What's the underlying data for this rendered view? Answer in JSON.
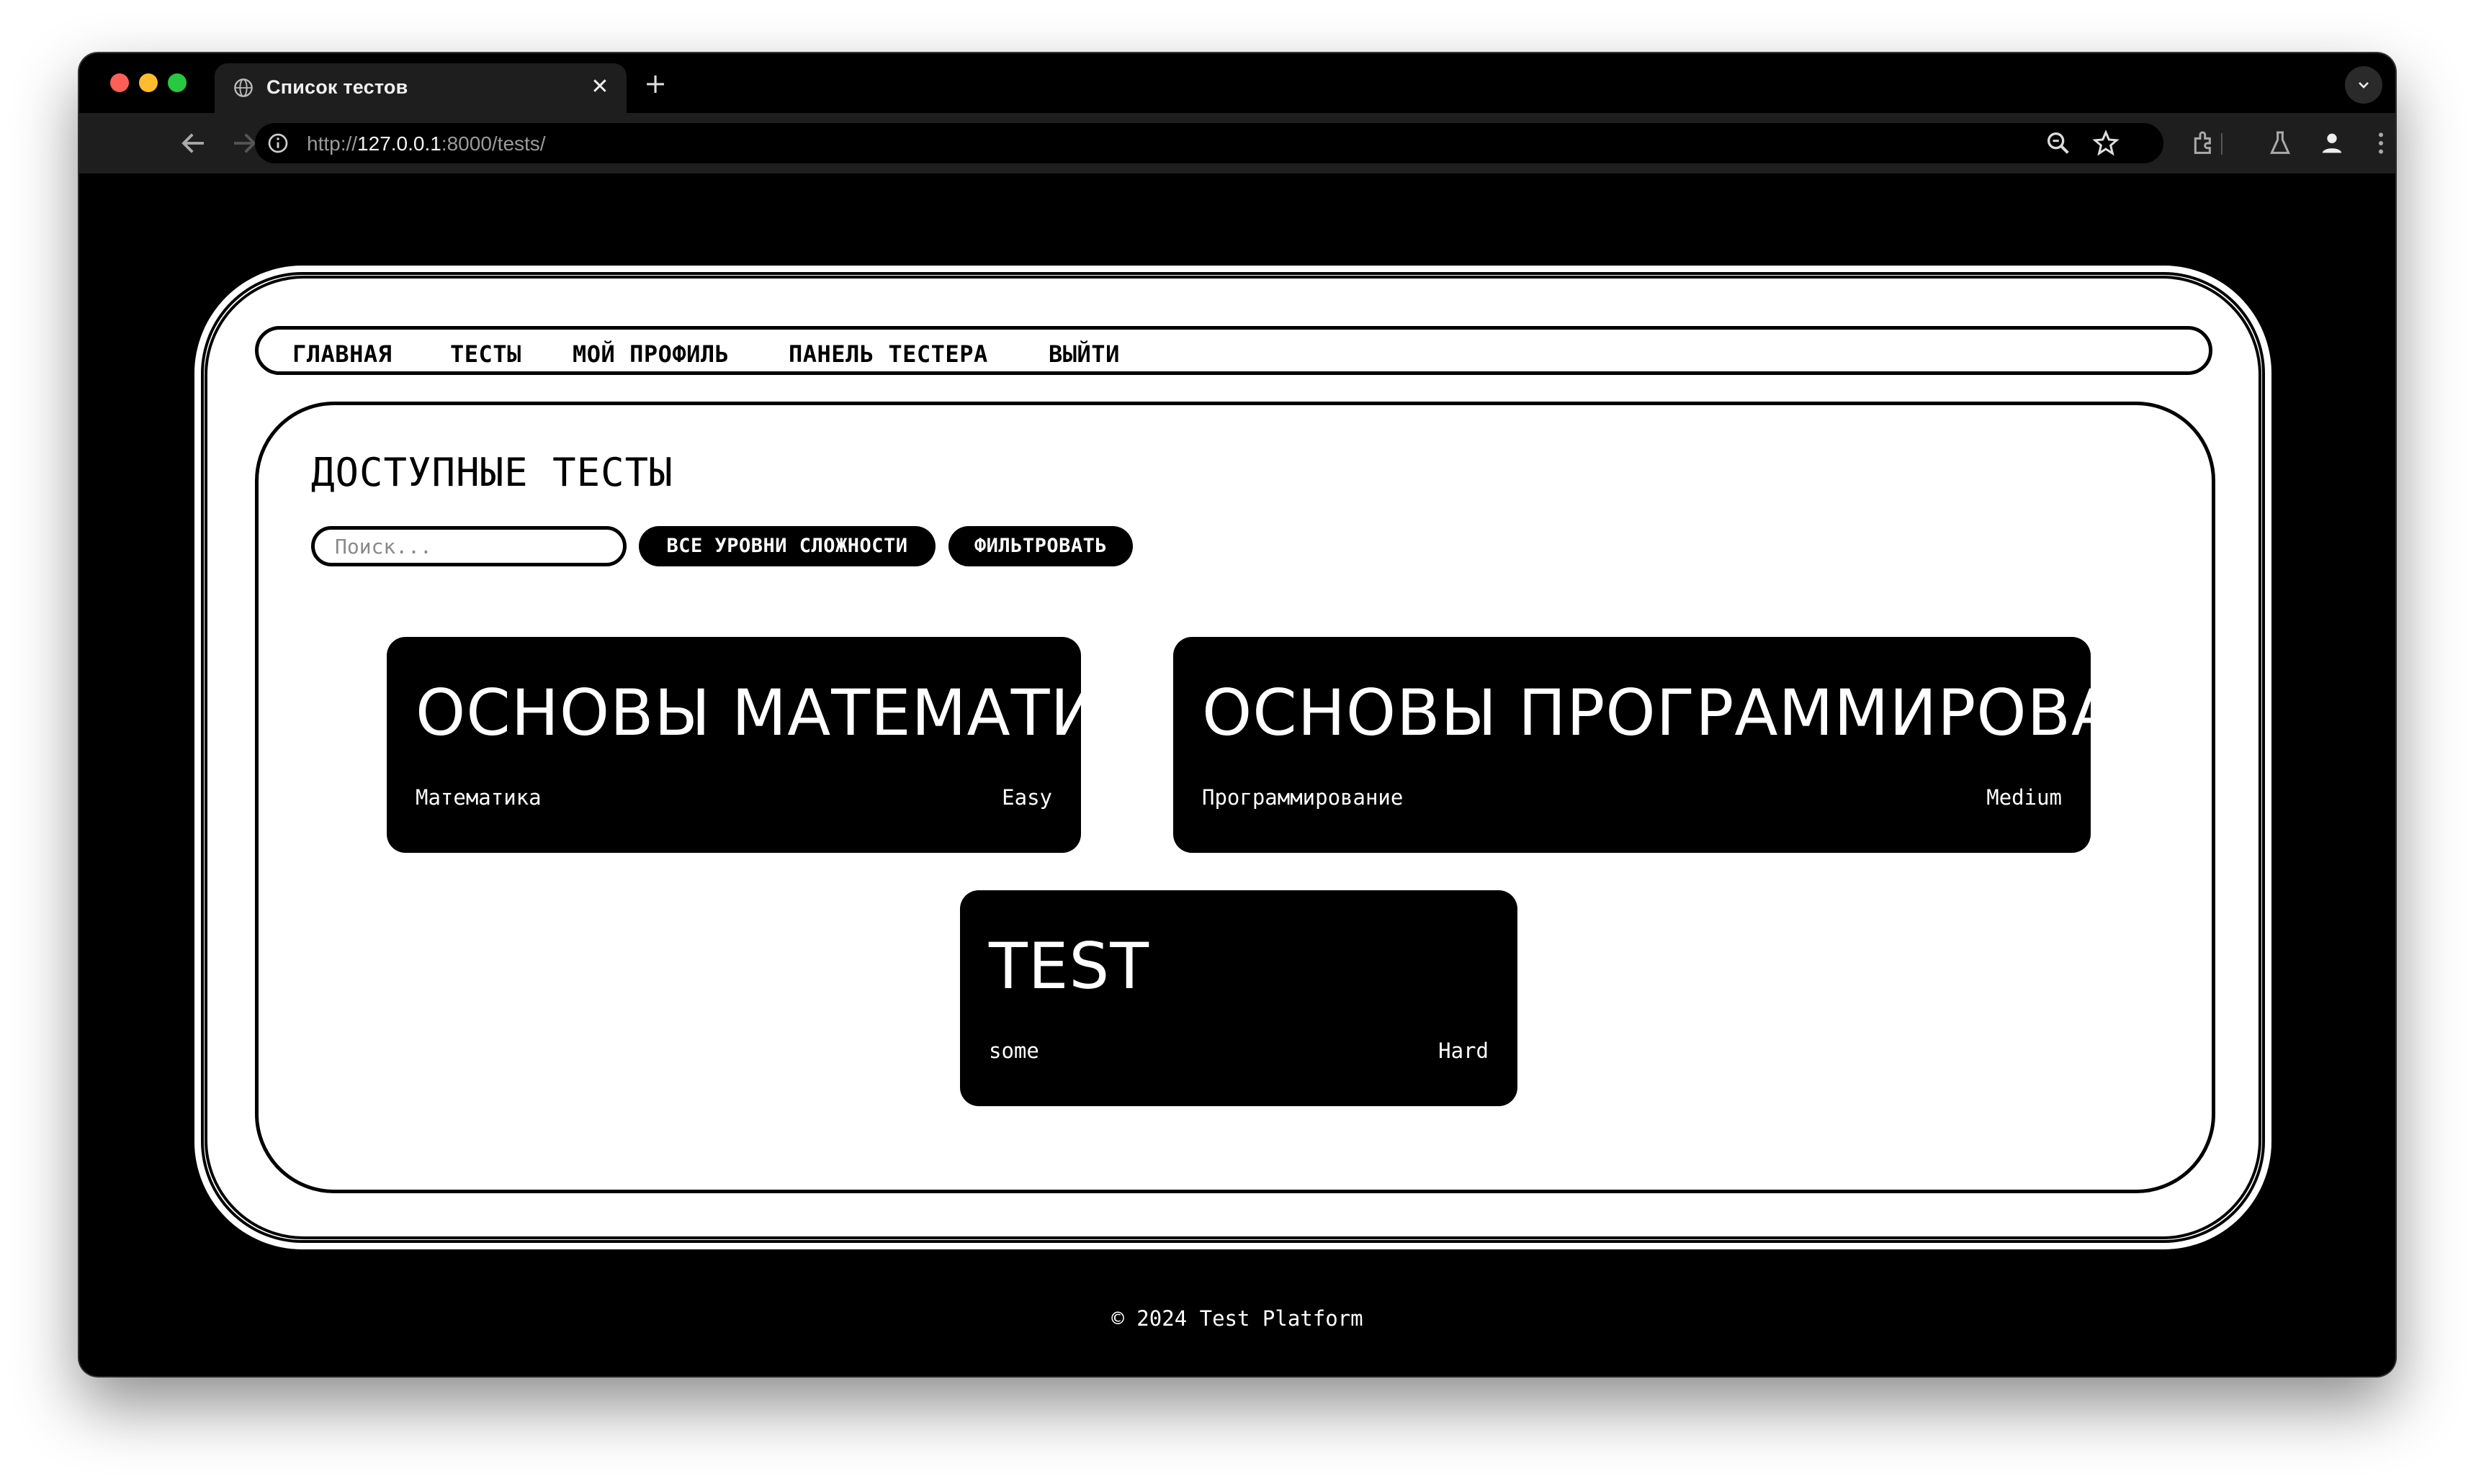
{
  "browser": {
    "tab": {
      "title": "Список тестов"
    },
    "url": {
      "scheme": "http://",
      "host": "127.0.0.1",
      "rest": ":8000/tests/"
    }
  },
  "nav": {
    "items": [
      {
        "label": "ГЛАВНАЯ"
      },
      {
        "label": "ТЕСТЫ"
      },
      {
        "label": "МОЙ ПРОФИЛЬ"
      },
      {
        "label": "ПАНЕЛЬ ТЕСТЕРА"
      },
      {
        "label": "ВЫЙТИ"
      }
    ]
  },
  "main": {
    "heading": "ДОСТУПНЫЕ ТЕСТЫ",
    "search": {
      "placeholder": "Поиск...",
      "value": ""
    },
    "difficulty_select": {
      "selected": "ВСЕ УРОВНИ СЛОЖНОСТИ"
    },
    "filter_button": "ФИЛЬТРОВАТЬ",
    "tests": [
      {
        "title": "ОСНОВЫ МАТЕМАТИКИ",
        "category": "Математика",
        "difficulty": "Easy"
      },
      {
        "title": "ОСНОВЫ ПРОГРАММИРОВАНИЯ",
        "category": "Программирование",
        "difficulty": "Medium"
      },
      {
        "title": "TEST",
        "category": "some",
        "difficulty": "Hard"
      }
    ]
  },
  "footer": {
    "text": "© 2024 Test Platform"
  },
  "colors": {
    "page_bg": "#000000",
    "card_bg": "#ffffff",
    "accent": "#000000",
    "tab_bg": "#1e1e1e"
  }
}
